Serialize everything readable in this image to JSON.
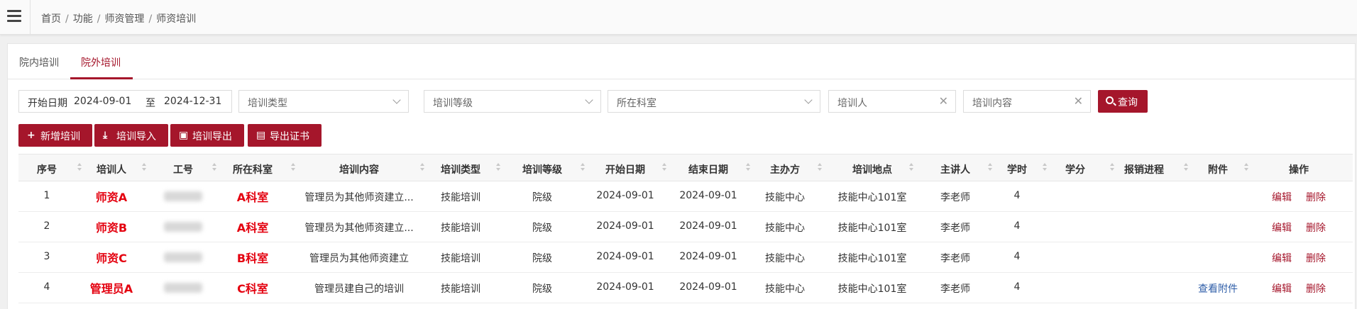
{
  "breadcrumb": [
    "首页",
    "功能",
    "师资管理",
    "师资培训"
  ],
  "tabs": [
    {
      "label": "院内培训",
      "active": false
    },
    {
      "label": "院外培训",
      "active": true
    }
  ],
  "filters": {
    "start_label": "开始日期",
    "start_date": "2024-09-01",
    "to_label": "至",
    "end_date": "2024-12-31",
    "type_placeholder": "培训类型",
    "level_placeholder": "培训等级",
    "dept_placeholder": "所在科室",
    "trainee_placeholder": "培训人",
    "content_placeholder": "培训内容",
    "search_label": "查询"
  },
  "actions": {
    "add": "新增培训",
    "import": "培训导入",
    "export": "培训导出",
    "export_cert": "导出证书"
  },
  "columns": [
    "序号",
    "培训人",
    "工号",
    "所在科室",
    "培训内容",
    "培训类型",
    "培训等级",
    "开始日期",
    "结束日期",
    "主办方",
    "培训地点",
    "主讲人",
    "学时",
    "学分",
    "报销进程",
    "附件",
    "操作"
  ],
  "rows": [
    {
      "no": "1",
      "trainee": "师资A",
      "dept": "A科室",
      "content": "管理员为其他师资建立...",
      "type": "技能培训",
      "level": "院级",
      "start": "2024-09-01",
      "end": "2024-09-01",
      "host": "技能中心",
      "place": "技能中心101室",
      "speaker": "李老师",
      "hours": "4",
      "attachment": "",
      "edit": "编辑",
      "delete": "删除"
    },
    {
      "no": "2",
      "trainee": "师资B",
      "dept": "A科室",
      "content": "管理员为其他师资建立...",
      "type": "技能培训",
      "level": "院级",
      "start": "2024-09-01",
      "end": "2024-09-01",
      "host": "技能中心",
      "place": "技能中心101室",
      "speaker": "李老师",
      "hours": "4",
      "attachment": "",
      "edit": "编辑",
      "delete": "删除"
    },
    {
      "no": "3",
      "trainee": "师资C",
      "dept": "B科室",
      "content": "管理员为其他师资建立",
      "type": "技能培训",
      "level": "院级",
      "start": "2024-09-01",
      "end": "2024-09-01",
      "host": "技能中心",
      "place": "技能中心101室",
      "speaker": "李老师",
      "hours": "4",
      "attachment": "",
      "edit": "编辑",
      "delete": "删除"
    },
    {
      "no": "4",
      "trainee": "管理员A",
      "dept": "C科室",
      "content": "管理员建自己的培训",
      "type": "技能培训",
      "level": "院级",
      "start": "2024-09-01",
      "end": "2024-09-01",
      "host": "技能中心",
      "place": "技能中心101室",
      "speaker": "李老师",
      "hours": "4",
      "attachment": "查看附件",
      "edit": "编辑",
      "delete": "删除"
    }
  ],
  "colors": {
    "accent": "#a5162b",
    "link_blue": "#2f5ea8",
    "annotation_red": "#e4000f"
  }
}
